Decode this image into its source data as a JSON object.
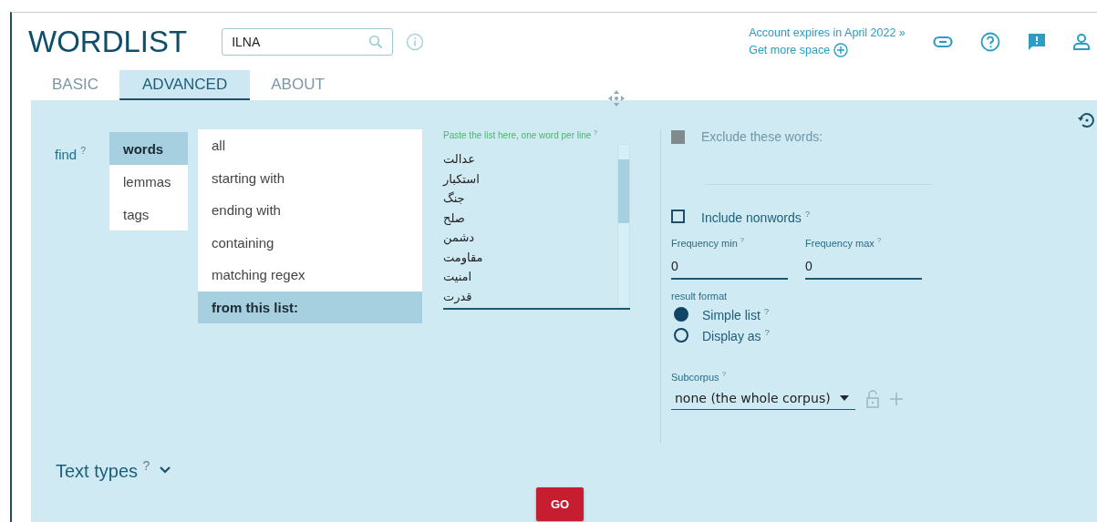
{
  "app_title": "WORDLIST",
  "search": {
    "value": "ILNA"
  },
  "account": {
    "expires": "Account expires in April 2022 »",
    "more_space": "Get more space"
  },
  "tabs": [
    {
      "label": "BASIC",
      "selected": false
    },
    {
      "label": "ADVANCED",
      "selected": true
    },
    {
      "label": "ABOUT",
      "selected": false
    }
  ],
  "find_label": "find $^{?}$",
  "find_types": [
    {
      "label": "words",
      "selected": true
    },
    {
      "label": "lemmas",
      "selected": false
    },
    {
      "label": "tags",
      "selected": false
    }
  ],
  "match_modes": [
    {
      "label": "all",
      "selected": false
    },
    {
      "label": "starting with",
      "selected": false
    },
    {
      "label": "ending with",
      "selected": false
    },
    {
      "label": "containing",
      "selected": false
    },
    {
      "label": "matching regex",
      "selected": false
    },
    {
      "label": "from this list:",
      "selected": true
    }
  ],
  "word_list": {
    "label": "Paste the list here, one word per line $^{?}$",
    "words": [
      "عدالت",
      "استکبار",
      "جنگ",
      "صلح",
      "دشمن",
      "مقاومت",
      "امنیت",
      "قدرت"
    ]
  },
  "exclude": {
    "label": "Exclude these words:",
    "disabled": true
  },
  "include_nonwords": {
    "label": "Include nonwords $^{?}$",
    "checked": false
  },
  "frequency_min": {
    "label": "Frequency min $^{?}$",
    "value": "0"
  },
  "frequency_max": {
    "label": "Frequency max $^{?}$",
    "value": "0"
  },
  "result_format": {
    "label": "result format",
    "options": [
      {
        "label": "Simple list $^{?}$",
        "selected": true
      },
      {
        "label": "Display as $^{?}$",
        "selected": false
      }
    ]
  },
  "subcorpus": {
    "label": "Subcorpus $^{?}$",
    "value": "none (the whole corpus)"
  },
  "text_types": "Text types $^{?}$",
  "go_button": "GO"
}
